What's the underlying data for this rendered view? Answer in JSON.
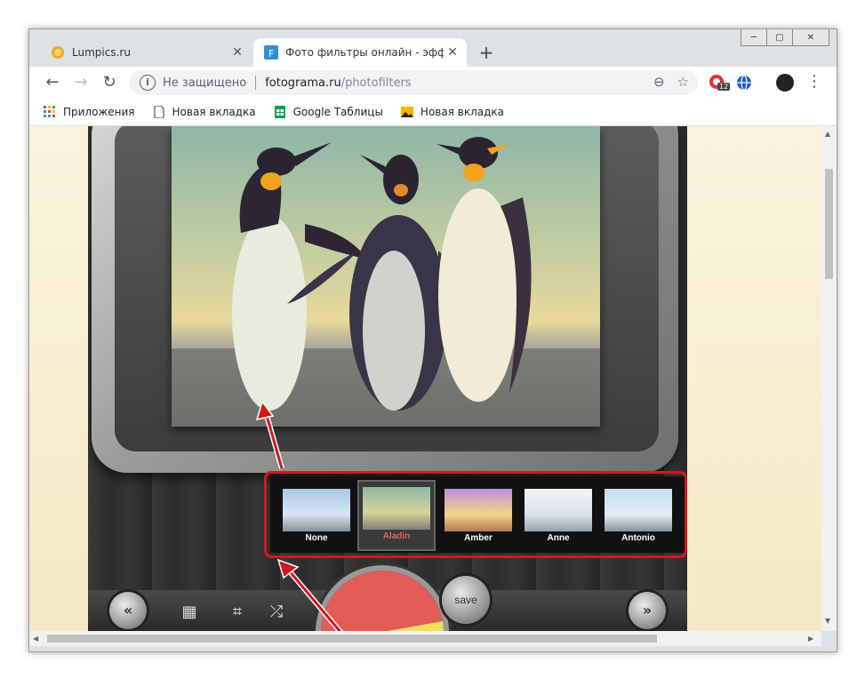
{
  "tabs": [
    {
      "title": "Lumpics.ru",
      "close": "✕",
      "active": false
    },
    {
      "title": "Фото фильтры онлайн - эффект",
      "close": "✕",
      "active": true
    }
  ],
  "new_tab_label": "+",
  "window_controls": {
    "minimize": "─",
    "maximize": "▢",
    "close": "✕"
  },
  "nav": {
    "back": "←",
    "forward": "→",
    "reload": "↻"
  },
  "address": {
    "security": "Не защищено",
    "host": "fotograma.ru",
    "path": "/photofilters",
    "zoom_icon": "⊖",
    "star_icon": "☆"
  },
  "extension_badge": "12",
  "menu_dots": "⋮",
  "bookmarks": [
    {
      "label": "Приложения",
      "icon": "apps-grid-icon"
    },
    {
      "label": "Новая вкладка",
      "icon": "page-icon"
    },
    {
      "label": "Google Таблицы",
      "icon": "sheets-icon"
    },
    {
      "label": "Новая вкладка",
      "icon": "image-icon"
    }
  ],
  "filters": [
    {
      "label": "None",
      "selected": false
    },
    {
      "label": "Aladin",
      "selected": true
    },
    {
      "label": "Amber",
      "selected": false
    },
    {
      "label": "Anne",
      "selected": false
    },
    {
      "label": "Antonio",
      "selected": false
    }
  ],
  "controls": {
    "prev": "«",
    "next": "»",
    "save": "save",
    "film_icon": "▦",
    "crop_icon": "⌗",
    "shuffle_icon": "⤮"
  },
  "colors": {
    "highlight": "#d0181e",
    "selected_label": "#e06060"
  }
}
